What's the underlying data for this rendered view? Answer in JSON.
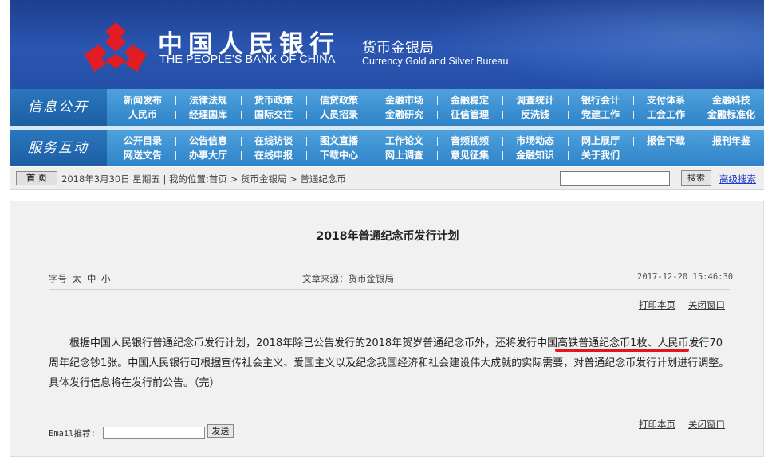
{
  "header": {
    "bank_cn": "中国人民银行",
    "bank_en": "THE PEOPLE'S BANK OF CHINA",
    "bureau_cn": "货币金银局",
    "bureau_en": "Currency  Gold and Silver Bureau",
    "logo_color": "#e31b23",
    "banner_color": "#2a56b2"
  },
  "nav": {
    "section1_title": "信息公开",
    "section1_items": [
      "新闻发布",
      "法律法规",
      "货币政策",
      "信贷政策",
      "金融市场",
      "金融稳定",
      "调查统计",
      "银行会计",
      "支付体系",
      "金融科技",
      "人民币",
      "经理国库",
      "国际交往",
      "人员招录",
      "金融研究",
      "征信管理",
      "反洗钱",
      "党建工作",
      "工会工作",
      "金融标准化"
    ],
    "section2_title": "服务互动",
    "section2_items": [
      "公开目录",
      "公告信息",
      "在线访谈",
      "图文直播",
      "工作论文",
      "音频视频",
      "市场动态",
      "网上展厅",
      "报告下载",
      "报刊年鉴",
      "网送文告",
      "办事大厅",
      "在线申报",
      "下载中心",
      "网上调查",
      "意见征集",
      "金融知识",
      "关于我们",
      "",
      ""
    ]
  },
  "infobar": {
    "home_label": "首 页",
    "breadcrumb": "2018年3月30日 星期五 | 我的位置:首页 > 货币金银局 > 普通纪念币",
    "search_value": "",
    "search_button": "搜索",
    "advanced_link": "高级搜索"
  },
  "article": {
    "title": "2018年普通纪念币发行计划",
    "fontsize_label": "字号",
    "size_large": "太",
    "size_medium": "中",
    "size_small": "小",
    "source": "文章来源：货币金银局",
    "date": "2017-12-20 15:46:30",
    "print_link": "打印本页",
    "close_link": "关闭窗口",
    "body": "根据中国人民银行普通纪念币发行计划，2018年除已公告发行的2018年贺岁普通纪念币外，还将发行中国高铁普通纪念币1枚、人民币发行70周年纪念钞1张。中国人民银行可根据宣传社会主义、爱国主义以及纪念我国经济和社会建设伟大成就的实际需要，对普通纪念币发行计划进行调整。具体发行信息将在发行前公告。（完）",
    "highlight_color": "#e1171d",
    "email_label": "Email推荐:",
    "email_value": "",
    "send_button": "发送"
  }
}
